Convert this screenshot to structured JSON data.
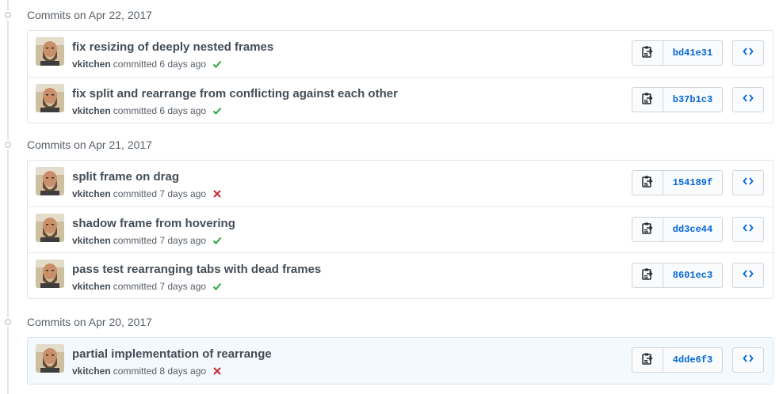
{
  "groups": [
    {
      "title": "Commits on Apr 22, 2017",
      "commits": [
        {
          "title": "fix resizing of deeply nested frames",
          "author": "vkitchen",
          "meta": "committed 6 days ago",
          "status": "success",
          "sha": "bd41e31",
          "highlight": false
        },
        {
          "title": "fix split and rearrange from conflicting against each other",
          "author": "vkitchen",
          "meta": "committed 6 days ago",
          "status": "success",
          "sha": "b37b1c3",
          "highlight": false
        }
      ]
    },
    {
      "title": "Commits on Apr 21, 2017",
      "commits": [
        {
          "title": "split frame on drag",
          "author": "vkitchen",
          "meta": "committed 7 days ago",
          "status": "failure",
          "sha": "154189f",
          "highlight": false
        },
        {
          "title": "shadow frame from hovering",
          "author": "vkitchen",
          "meta": "committed 7 days ago",
          "status": "success",
          "sha": "dd3ce44",
          "highlight": false
        },
        {
          "title": "pass test rearranging tabs with dead frames",
          "author": "vkitchen",
          "meta": "committed 7 days ago",
          "status": "success",
          "sha": "8601ec3",
          "highlight": false
        }
      ]
    },
    {
      "title": "Commits on Apr 20, 2017",
      "commits": [
        {
          "title": "partial implementation of rearrange",
          "author": "vkitchen",
          "meta": "committed 8 days ago",
          "status": "failure",
          "sha": "4dde6f3",
          "highlight": true
        }
      ]
    }
  ],
  "icons": {
    "copy": "clippy-icon",
    "browse": "code-icon",
    "success": "check-icon",
    "failure": "x-icon",
    "node": "git-commit-icon"
  },
  "colors": {
    "success": "#28a745",
    "failure": "#cb2431",
    "sha": "#0366d6",
    "highlight_row": "#f4f9fd"
  }
}
